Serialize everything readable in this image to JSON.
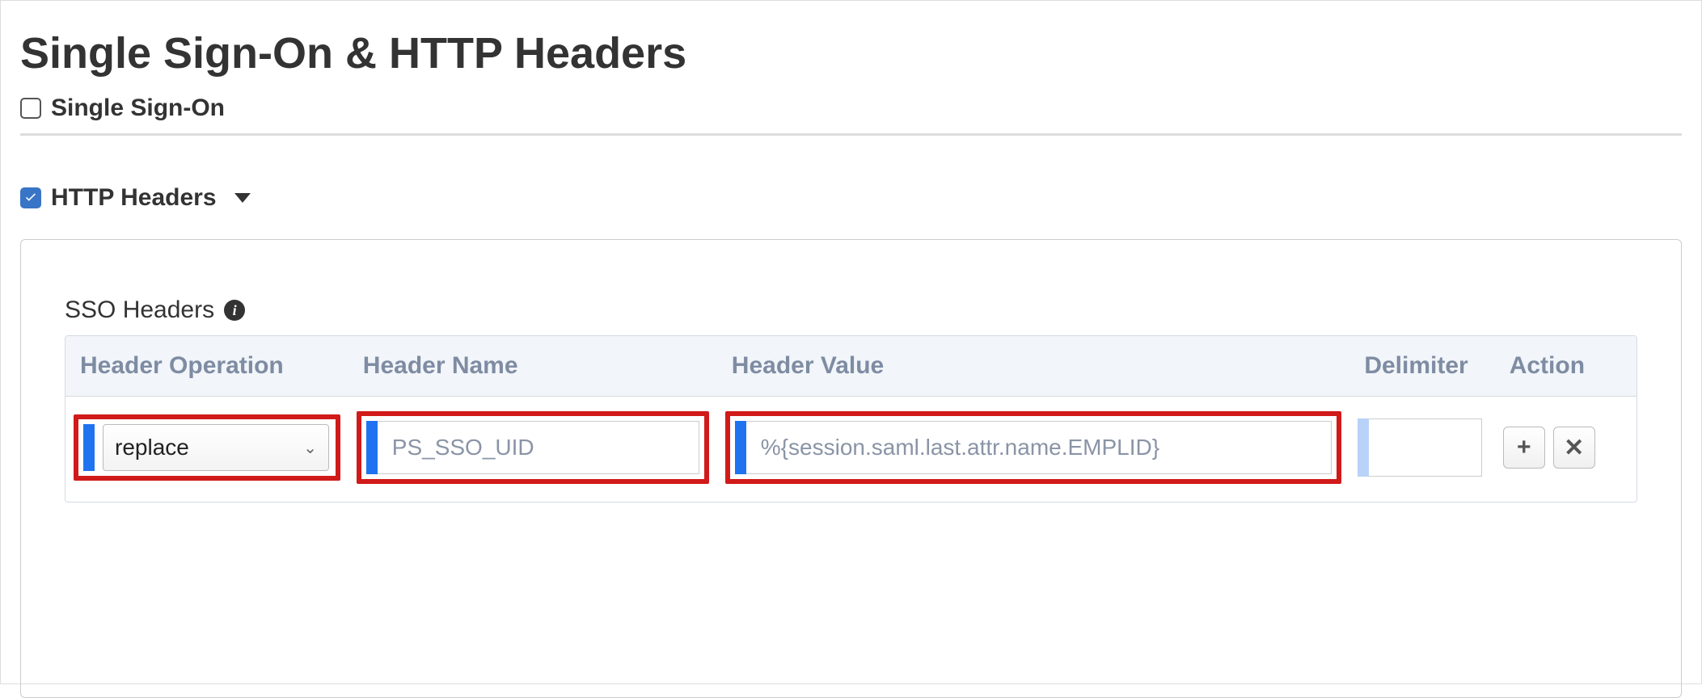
{
  "page": {
    "title": "Single Sign-On & HTTP Headers"
  },
  "sections": {
    "sso": {
      "label": "Single Sign-On",
      "checked": false
    },
    "http_headers": {
      "label": "HTTP Headers",
      "checked": true
    }
  },
  "sso_headers": {
    "label": "SSO Headers",
    "columns": {
      "operation": "Header Operation",
      "name": "Header Name",
      "value": "Header Value",
      "delimiter": "Delimiter",
      "action": "Action"
    },
    "row": {
      "operation_selected": "replace",
      "name": "PS_SSO_UID",
      "value": "%{session.saml.last.attr.name.EMPLID}",
      "delimiter": ""
    }
  },
  "icons": {
    "info": "i",
    "plus": "+",
    "close": "✕",
    "caret": "⌄"
  }
}
